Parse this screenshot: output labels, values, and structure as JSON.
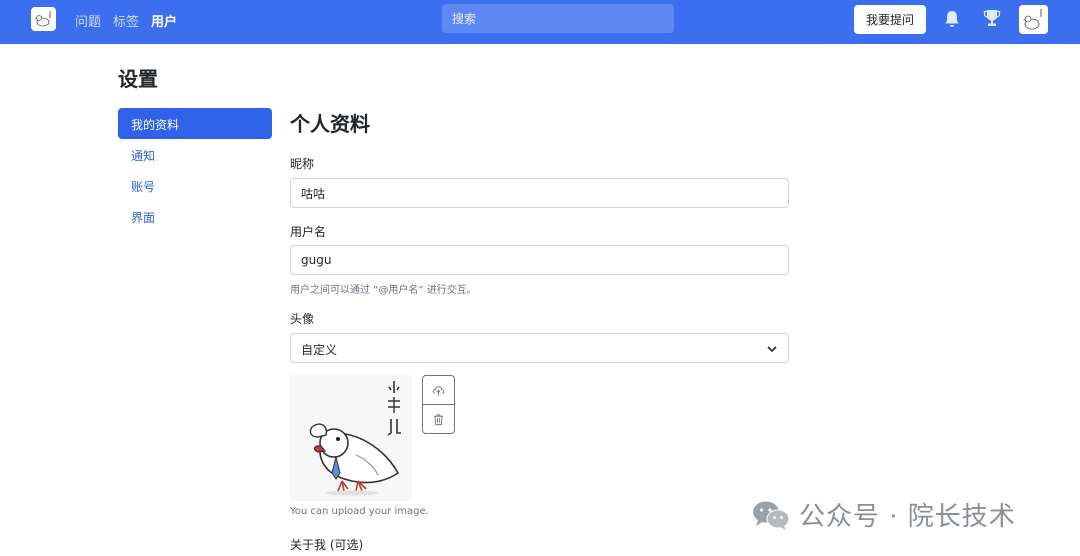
{
  "nav": {
    "links": [
      "问题",
      "标签",
      "用户"
    ],
    "search_placeholder": "搜索",
    "ask_button": "我要提问"
  },
  "page": {
    "title": "设置"
  },
  "sidebar": {
    "items": [
      {
        "label": "我的资料"
      },
      {
        "label": "通知"
      },
      {
        "label": "账号"
      },
      {
        "label": "界面"
      }
    ]
  },
  "profile": {
    "section_title": "个人资料",
    "nickname_label": "昵称",
    "nickname_value": "咕咕",
    "username_label": "用户名",
    "username_value": "gugu",
    "username_help": "用户之间可以通过 “@用户名” 进行交互。",
    "avatar_label": "头像",
    "avatar_select": "自定义",
    "avatar_help": "You can upload your image.",
    "about_label": "关于我 (可选)"
  },
  "watermark": {
    "text": "公众号 · 院长技术"
  },
  "colors": {
    "brand": "#3c6ff0",
    "sidebar_active": "#2f62e9"
  }
}
